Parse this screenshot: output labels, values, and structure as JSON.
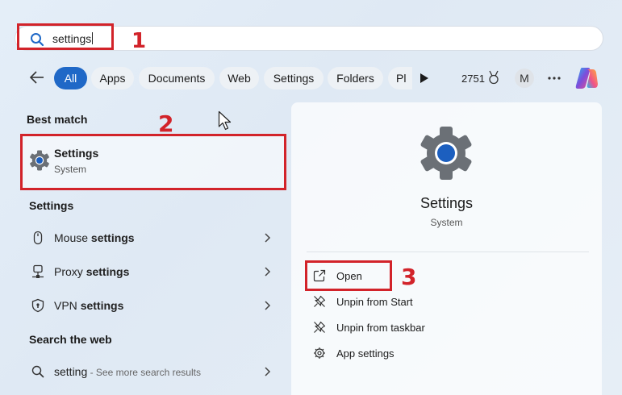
{
  "search": {
    "query": "settings"
  },
  "filters": {
    "chips": [
      "All",
      "Apps",
      "Documents",
      "Web",
      "Settings",
      "Folders",
      "Pl"
    ],
    "active": "All",
    "points": "2751",
    "avatar_initial": "M"
  },
  "left": {
    "best_match_title": "Best match",
    "best_match": {
      "name": "Settings",
      "subtitle": "System"
    },
    "settings_section_title": "Settings",
    "settings_items": [
      {
        "prefix": "Mouse ",
        "bold": "settings"
      },
      {
        "prefix": "Proxy ",
        "bold": "settings"
      },
      {
        "prefix": "VPN ",
        "bold": "settings"
      }
    ],
    "web_section_title": "Search the web",
    "web_item": {
      "query": "setting",
      "suffix": " - See more search results"
    }
  },
  "right": {
    "title": "Settings",
    "subtitle": "System",
    "actions": [
      "Open",
      "Unpin from Start",
      "Unpin from taskbar",
      "App settings"
    ]
  },
  "annotations": [
    "1",
    "2",
    "3"
  ],
  "colors": {
    "accent": "#1f68c7",
    "annotation": "#d2232a",
    "gear": "#6b7076",
    "gear_center": "#1c5fbf"
  },
  "icons": {
    "search": "search-icon",
    "back": "back-arrow-icon",
    "play": "play-icon",
    "medal": "medal-icon",
    "more": "more-icon",
    "copilot": "copilot-icon",
    "gear": "gear-icon",
    "mouse": "mouse-icon",
    "proxy": "proxy-icon",
    "vpn": "shield-icon",
    "chevron": "chevron-right-icon",
    "open": "open-external-icon",
    "unpin": "unpin-icon",
    "app-settings": "app-settings-gear-icon"
  }
}
